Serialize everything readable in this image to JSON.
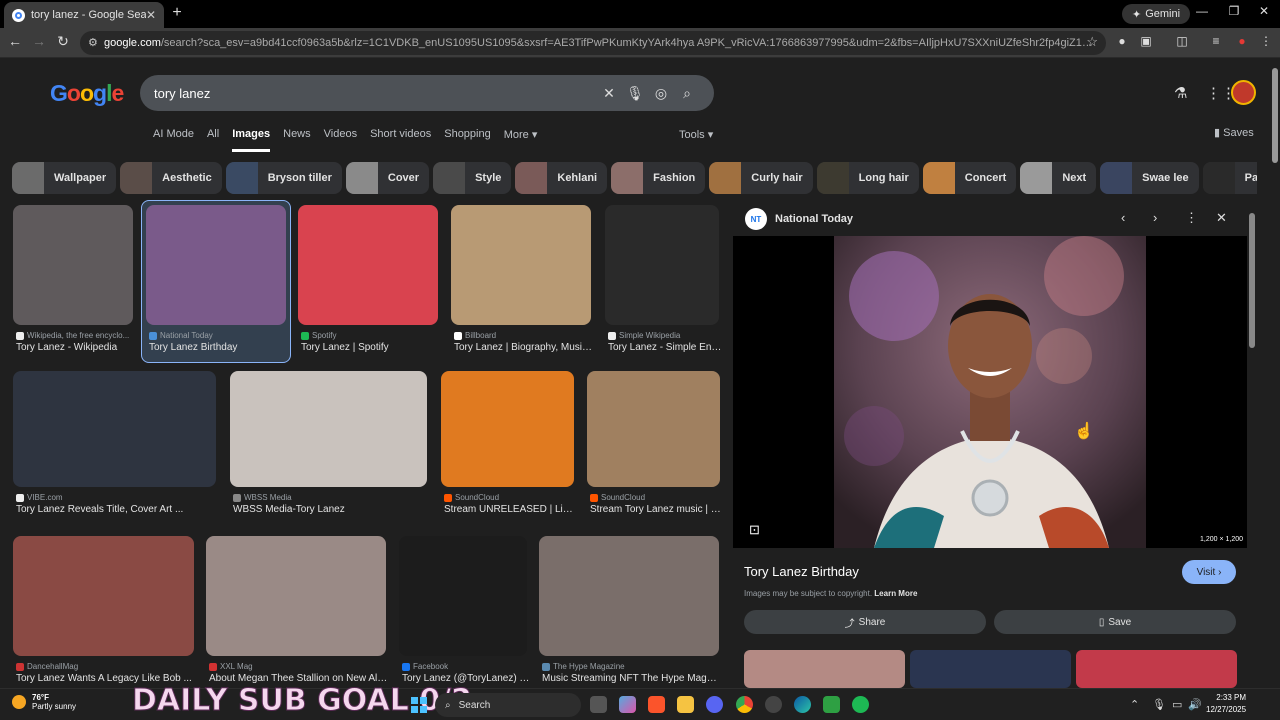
{
  "browser": {
    "tab_title": "tory lanez - Google Search",
    "new_tab": "+",
    "gemini_label": "Gemini",
    "url_host": "google.com",
    "url_rest": "/search?sca_esv=a9bd41ccf0963a5b&rlz=1C1VDKB_enUS1095US1095&sxsrf=AE3TifPwPKumKtyYArk4hya A9PK_vRicVA:1766863977995&udm=2&fbs=AIljpHxU7SXXniUZfeShr2fp4giZ1Y6MJ25_tmWITc7uy4KIedDdErwP5rACe..."
  },
  "search": {
    "query": "tory lanez",
    "tabs": [
      "AI Mode",
      "All",
      "Images",
      "News",
      "Videos",
      "Short videos",
      "Shopping",
      "More ▾"
    ],
    "active_tab": "Images",
    "tools_label": "Tools ▾",
    "saves_label": "Saves"
  },
  "chips": [
    {
      "label": "Wallpaper",
      "color": "#6b6b6b"
    },
    {
      "label": "Aesthetic",
      "color": "#5a4d48"
    },
    {
      "label": "Bryson tiller",
      "color": "#3a4a63"
    },
    {
      "label": "Cover",
      "color": "#8a8a8a"
    },
    {
      "label": "Style",
      "color": "#4a4a4a"
    },
    {
      "label": "Kehlani",
      "color": "#7a5a58"
    },
    {
      "label": "Fashion",
      "color": "#8c6e6a"
    },
    {
      "label": "Curly hair",
      "color": "#a07040"
    },
    {
      "label": "Long hair",
      "color": "#3d3a30"
    },
    {
      "label": "Concert",
      "color": "#c08040"
    },
    {
      "label": "Next",
      "color": "#9a9a9a"
    },
    {
      "label": "Swae lee",
      "color": "#3a4560"
    },
    {
      "label": "Partynextdoor",
      "color": "#2a2a2a"
    },
    {
      "label": "",
      "color": "#5a6a5a"
    }
  ],
  "results_row1": [
    {
      "source": "Wikipedia, the free encyclo...",
      "title": "Tory Lanez - Wikipedia",
      "color": "#5f5a5c",
      "src_color": "#eeeeee"
    },
    {
      "source": "National Today",
      "title": "Tory Lanez Birthday",
      "color": "#7a5a8a",
      "src_color": "#4a90d9"
    },
    {
      "source": "Spotify",
      "title": "Tory Lanez | Spotify",
      "color": "#d9434f",
      "src_color": "#1db954"
    },
    {
      "source": "Billboard",
      "title": "Tory Lanez | Biography, Music...",
      "color": "#b89a74",
      "src_color": "#ffffff"
    },
    {
      "source": "Simple Wikipedia",
      "title": "Tory Lanez - Simple Engl...",
      "color": "#2a2a2a",
      "src_color": "#eeeeee"
    }
  ],
  "results_row2": [
    {
      "source": "VIBE.com",
      "title": "Tory Lanez Reveals Title, Cover Art ...",
      "color": "#2e3440",
      "src_color": "#eeeeee"
    },
    {
      "source": "WBSS Media",
      "title": "WBSS Media-Tory Lanez",
      "color": "#c9c2bd",
      "src_color": "#888888"
    },
    {
      "source": "SoundCloud",
      "title": "Stream UNRELEASED | List...",
      "color": "#e07a20",
      "src_color": "#ff5500"
    },
    {
      "source": "SoundCloud",
      "title": "Stream Tory Lanez music | L...",
      "color": "#a08060",
      "src_color": "#ff5500"
    }
  ],
  "results_row3": [
    {
      "source": "DancehallMag",
      "title": "Tory Lanez Wants A Legacy Like Bob ...",
      "color": "#8a4a44",
      "src_color": "#cc3333"
    },
    {
      "source": "XXL Mag",
      "title": "About Megan Thee Stallion on New Alb...",
      "color": "#9a8a86",
      "src_color": "#d23232"
    },
    {
      "source": "Facebook",
      "title": "Tory Lanez (@ToryLanez) •...",
      "color": "#1c1c1c",
      "src_color": "#1877f2"
    },
    {
      "source": "The Hype Magazine",
      "title": "Music Streaming NFT The Hype Magaz...",
      "color": "#7a6e6a",
      "src_color": "#5a8ab0"
    }
  ],
  "panel": {
    "source": "National Today",
    "logo_text": "NT",
    "title": "Tory Lanez Birthday",
    "visit_label": "Visit ›",
    "copyright": "Images may be subject to copyright.",
    "learn_more": "Learn More",
    "share_label": "Share",
    "save_label": "Save",
    "dimensions": "1,200 × 1,200"
  },
  "taskbar": {
    "temp": "76°F",
    "weather": "Partly sunny",
    "overlay_text": "DAILY SUB GOAL 0/2",
    "search_label": "Search",
    "time": "2:33 PM",
    "date": "12/27/2025"
  },
  "colors": {
    "accent": "#8ab4f8",
    "page_bg": "#1f1f1f"
  }
}
